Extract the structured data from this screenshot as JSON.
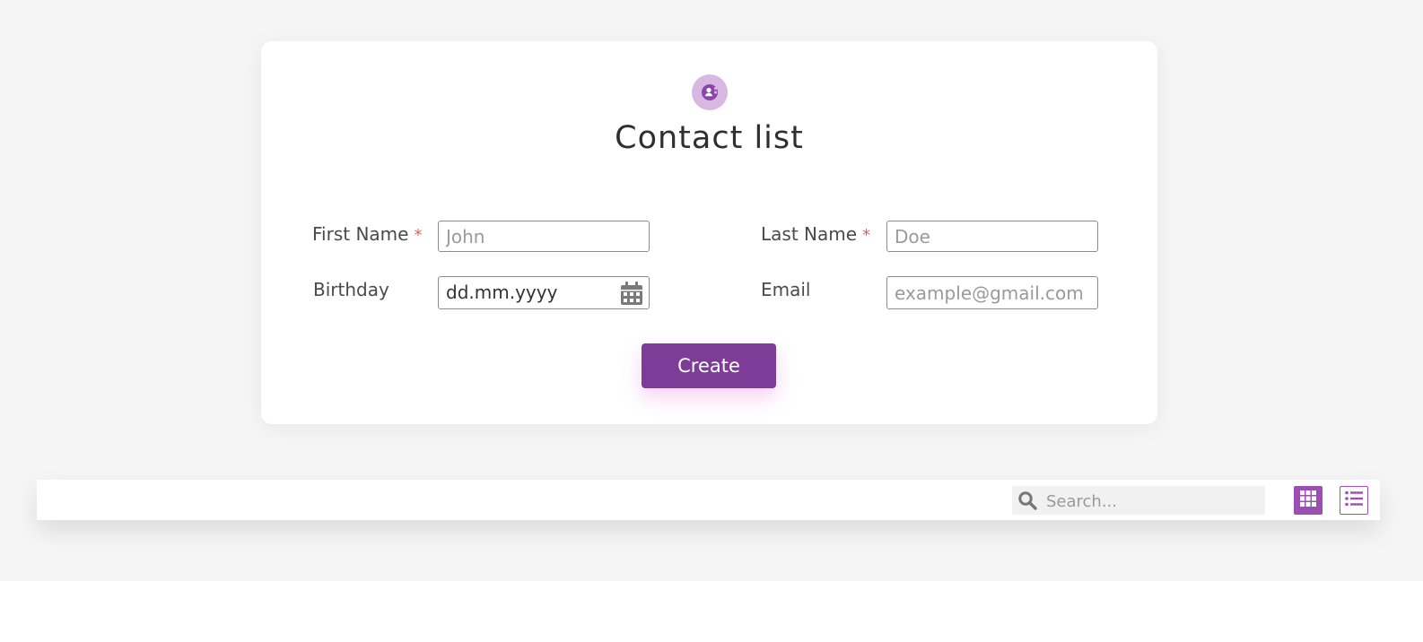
{
  "header": {
    "title": "Contact list"
  },
  "form": {
    "first_name": {
      "label": "First Name",
      "required_mark": "*",
      "placeholder": "John",
      "value": ""
    },
    "last_name": {
      "label": "Last Name",
      "required_mark": "*",
      "placeholder": "Doe",
      "value": ""
    },
    "birthday": {
      "label": "Birthday",
      "value": "dd.mm.yyyy"
    },
    "email": {
      "label": "Email",
      "placeholder": "example@gmail.com",
      "value": ""
    },
    "submit_label": "Create"
  },
  "toolbar": {
    "search_placeholder": "Search...",
    "search_value": "",
    "grid_view_active": true,
    "list_view_active": false
  },
  "icons": {
    "logo": "contact-avatar-icon",
    "calendar": "calendar-icon",
    "search": "search-icon",
    "grid": "grid-view-icon",
    "list": "list-view-icon"
  },
  "colors": {
    "accent": "#7d3c98",
    "accent_light": "#d8b8e2",
    "required": "#e25f5f",
    "page_background": "#f5f5f5"
  }
}
